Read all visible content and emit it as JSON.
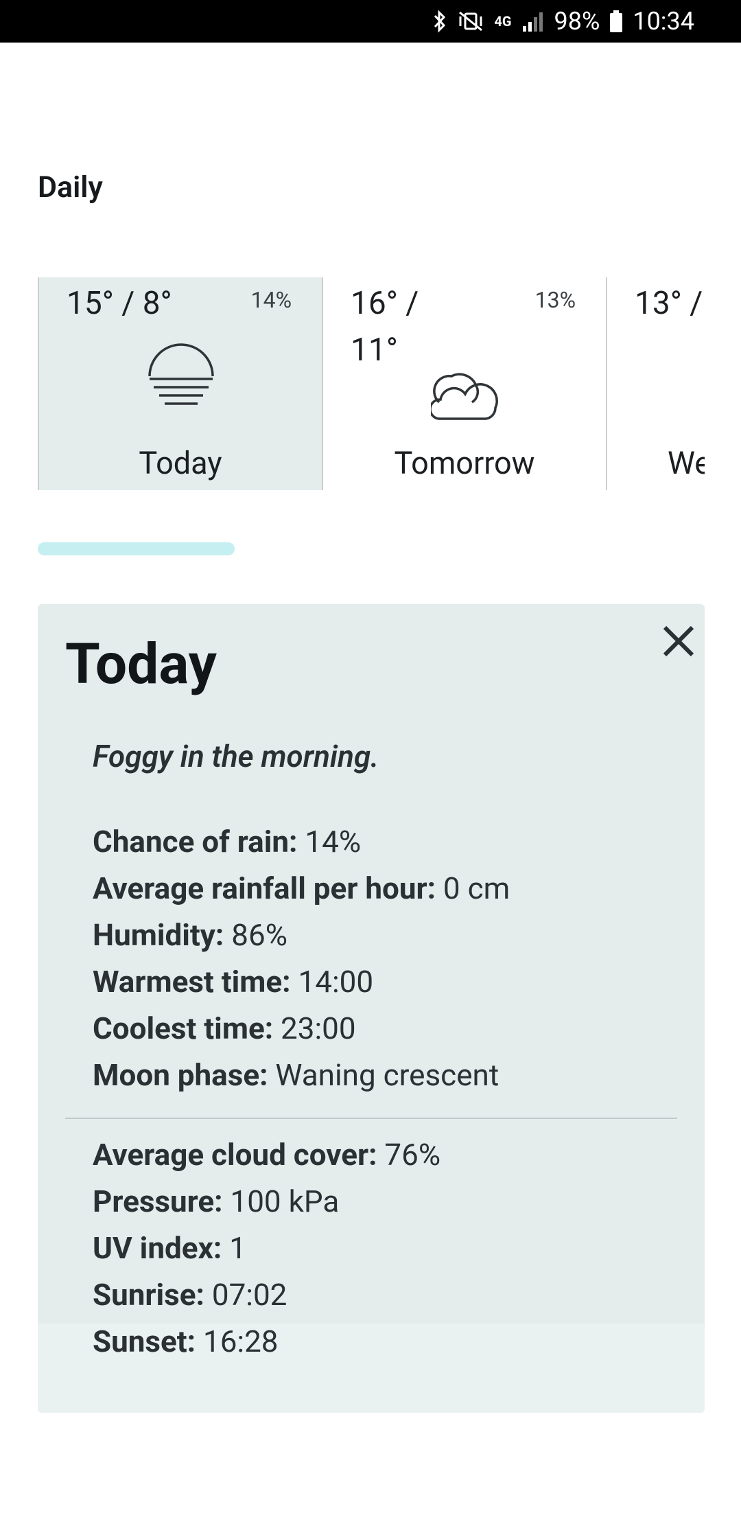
{
  "status_bar": {
    "network": "4G",
    "battery": "98%",
    "time": "10:34"
  },
  "section_title": "Daily",
  "daily_cards": [
    {
      "temp": "15° / 8°",
      "pop": "14%",
      "label": "Today",
      "icon": "fog-icon",
      "selected": true
    },
    {
      "temp": "16° / 11°",
      "pop": "13%",
      "label": "Tomorrow",
      "icon": "cloudy-icon",
      "selected": false
    },
    {
      "temp": "13° /",
      "label": "We",
      "selected": false
    }
  ],
  "scroll_progress": 0.3,
  "detail": {
    "title": "Today",
    "summary": "Foggy in the morning.",
    "facts": [
      {
        "label": "Chance of rain:",
        "value": "14%"
      },
      {
        "label": "Average rainfall per hour:",
        "value": "0 cm"
      },
      {
        "label": "Humidity:",
        "value": "86%"
      },
      {
        "label": "Warmest time:",
        "value": "14:00"
      },
      {
        "label": "Coolest time:",
        "value": "23:00"
      },
      {
        "label": "Moon phase:",
        "value": "Waning crescent"
      }
    ],
    "facts_more": [
      {
        "label": "Average cloud cover:",
        "value": "76%"
      },
      {
        "label": "Pressure:",
        "value": "100 kPa"
      },
      {
        "label": "UV index:",
        "value": "1"
      },
      {
        "label": "Sunrise:",
        "value": "07:02"
      },
      {
        "label": "Sunset:",
        "value": "16:28"
      }
    ]
  },
  "colors": {
    "card_selected_bg": "#e4ecec",
    "scroll_indicator": "#c5eff0",
    "status_bar_bg": "#000000"
  }
}
